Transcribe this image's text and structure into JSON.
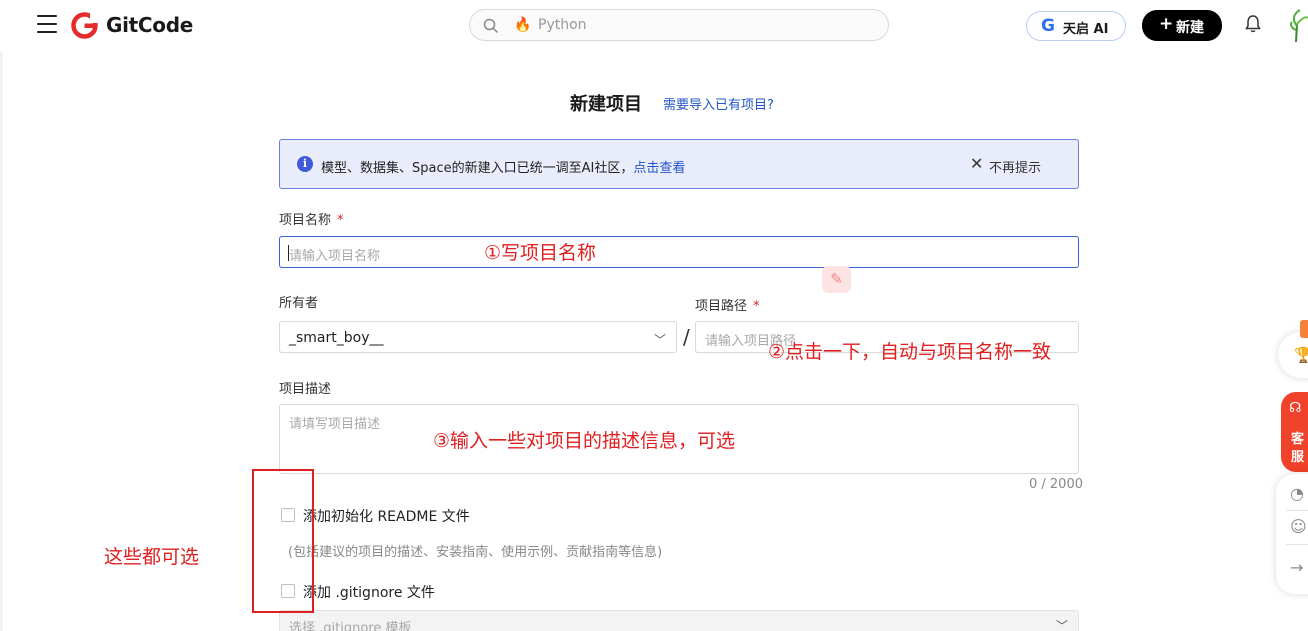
{
  "header": {
    "logo_text": "GitCode",
    "search_placeholder": "Python",
    "ai_button_label": "天启 AI",
    "ai_button_glyph": "G",
    "new_button_label": "新建",
    "new_button_plus": "+"
  },
  "page": {
    "title": "新建项目",
    "import_link": "需要导入已有项目?"
  },
  "notice": {
    "message": "模型、数据集、Space的新建入口已统一调至AI社区，",
    "link": "点击查看",
    "close_icon": "✕",
    "dismiss_label": "不再提示"
  },
  "form": {
    "project_name_label": "项目名称",
    "required_mark": "*",
    "project_name_placeholder": "请输入项目名称",
    "owner_label": "所有者",
    "owner_value": "_smart_boy__",
    "separator": "/",
    "project_path_label": "项目路径",
    "project_path_placeholder": "请输入项目路径",
    "description_label": "项目描述",
    "description_placeholder": "请填写项目描述",
    "description_counter": "0 / 2000",
    "readme_label": "添加初始化 README 文件",
    "readme_hint": "(包括建议的项目的描述、安装指南、使用示例、贡献指南等信息)",
    "gitignore_label": "添加 .gitignore 文件",
    "gitignore_placeholder": "选择 .gitignore 模板"
  },
  "annotations": {
    "step1": "①写项目名称",
    "step2": "②点击一下，自动与项目名称一致",
    "step3": "③输入一些对项目的描述信息，可选",
    "optional_note": "这些都可选"
  },
  "side_panel": {
    "service_line1": "客",
    "service_line2": "服"
  },
  "colors": {
    "brand_red": "#e62b2b",
    "accent_blue": "#3a5fd0",
    "annotation_red": "#e02020",
    "notice_bg": "#e9ecfb"
  }
}
